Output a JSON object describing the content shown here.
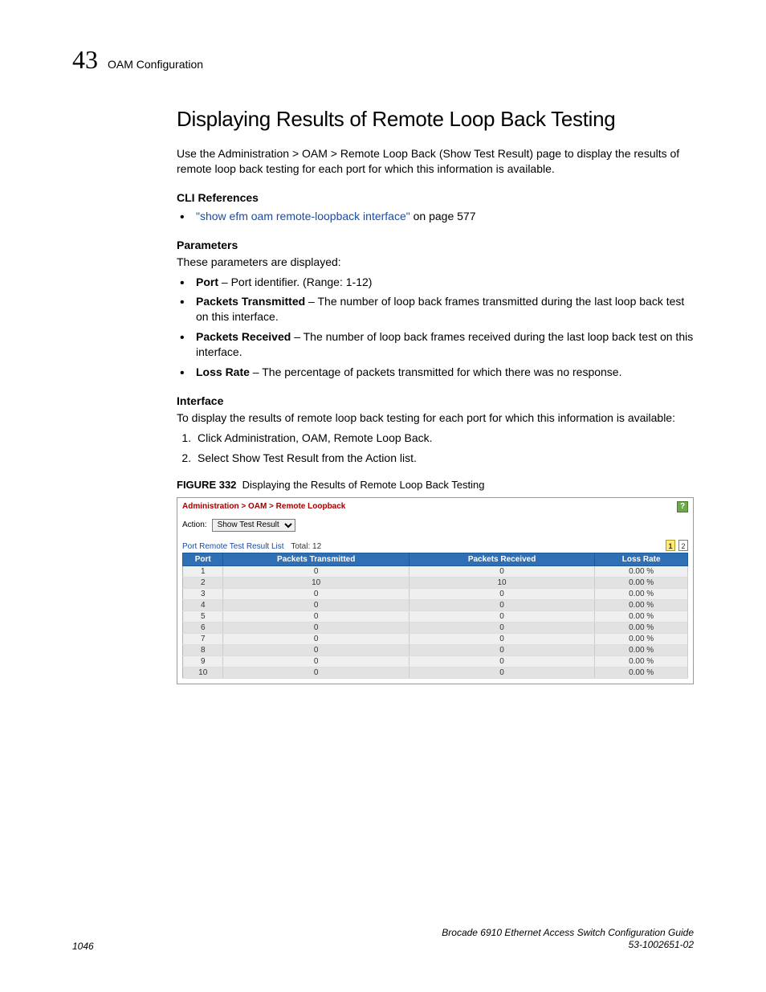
{
  "header": {
    "chapter": "43",
    "section": "OAM Configuration"
  },
  "title": "Displaying Results of Remote Loop Back Testing",
  "intro": "Use the Administration > OAM > Remote Loop Back (Show Test Result) page to display the results of remote loop back testing for each port for which this information is available.",
  "cli": {
    "heading": "CLI References",
    "link_text": "\"show efm oam remote-loopback interface\"",
    "link_suffix": " on page 577"
  },
  "params": {
    "heading": "Parameters",
    "intro": "These parameters are displayed:",
    "items": [
      {
        "name": "Port",
        "desc": " – Port identifier. (Range: 1-12)"
      },
      {
        "name": "Packets Transmitted",
        "desc": " – The number of loop back frames transmitted during the last loop back test on this interface."
      },
      {
        "name": "Packets Received",
        "desc": " – The number of loop back frames received during the last loop back test on this interface."
      },
      {
        "name": "Loss Rate",
        "desc": " – The percentage of packets transmitted for which there was no response."
      }
    ]
  },
  "interface": {
    "heading": "Interface",
    "intro": "To display the results of remote loop back testing for each port for which this information is available:",
    "steps": [
      "Click Administration, OAM, Remote Loop Back.",
      "Select Show Test Result from the Action list."
    ]
  },
  "figure": {
    "tag": "FIGURE 332",
    "caption": "Displaying the Results of Remote Loop Back Testing",
    "breadcrumb": "Administration > OAM > Remote Loopback",
    "help": "?",
    "action_label": "Action:",
    "action_value": "Show Test Result",
    "list_title": "Port Remote Test Result List",
    "total_label": "Total: 12",
    "pager": {
      "current": "1",
      "other": "2"
    },
    "columns": [
      "Port",
      "Packets Transmitted",
      "Packets Received",
      "Loss Rate"
    ],
    "rows": [
      {
        "port": "1",
        "tx": "0",
        "rx": "0",
        "loss": "0.00 %"
      },
      {
        "port": "2",
        "tx": "10",
        "rx": "10",
        "loss": "0.00 %"
      },
      {
        "port": "3",
        "tx": "0",
        "rx": "0",
        "loss": "0.00 %"
      },
      {
        "port": "4",
        "tx": "0",
        "rx": "0",
        "loss": "0.00 %"
      },
      {
        "port": "5",
        "tx": "0",
        "rx": "0",
        "loss": "0.00 %"
      },
      {
        "port": "6",
        "tx": "0",
        "rx": "0",
        "loss": "0.00 %"
      },
      {
        "port": "7",
        "tx": "0",
        "rx": "0",
        "loss": "0.00 %"
      },
      {
        "port": "8",
        "tx": "0",
        "rx": "0",
        "loss": "0.00 %"
      },
      {
        "port": "9",
        "tx": "0",
        "rx": "0",
        "loss": "0.00 %"
      },
      {
        "port": "10",
        "tx": "0",
        "rx": "0",
        "loss": "0.00 %"
      }
    ]
  },
  "footer": {
    "page": "1046",
    "doc_title": "Brocade 6910 Ethernet Access Switch Configuration Guide",
    "doc_num": "53-1002651-02"
  }
}
